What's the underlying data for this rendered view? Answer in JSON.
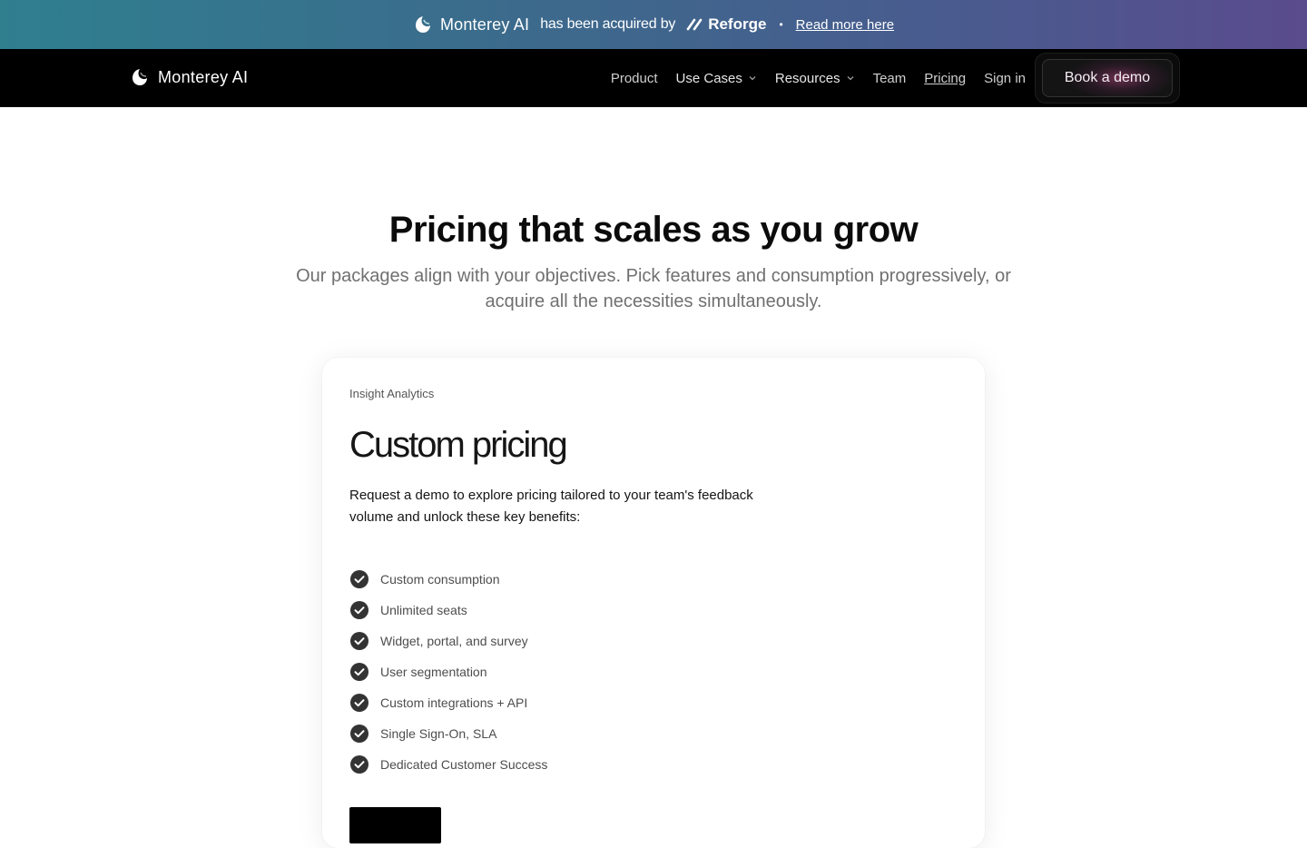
{
  "announcement": {
    "brand": "Monterey AI",
    "acquired_text": "has been acquired by",
    "acquirer": "Reforge",
    "separator": "•",
    "link": "Read more here"
  },
  "nav": {
    "logo_text": "Monterey AI",
    "links": [
      {
        "label": "Product",
        "dropdown": false
      },
      {
        "label": "Use Cases",
        "dropdown": true
      },
      {
        "label": "Resources",
        "dropdown": true
      },
      {
        "label": "Team",
        "dropdown": false
      },
      {
        "label": "Pricing",
        "dropdown": false,
        "active": true
      },
      {
        "label": "Sign in",
        "dropdown": false
      }
    ],
    "cta": "Book a demo"
  },
  "hero": {
    "title": "Pricing that scales as you grow",
    "subtitle": "Our packages align with your objectives. Pick features and consumption progressively, or acquire all the necessities simultaneously."
  },
  "card": {
    "eyebrow": "Insight Analytics",
    "price": "Custom pricing",
    "description": "Request a demo to explore pricing tailored to your team's feedback volume and unlock these key benefits:",
    "features": [
      "Custom consumption",
      "Unlimited seats",
      "Widget, portal, and survey",
      "User segmentation",
      "Custom integrations + API",
      "Single Sign-On, SLA",
      "Dedicated Customer Success"
    ]
  },
  "colors": {
    "announce_gradient_start": "#2f7f8f",
    "announce_gradient_end": "#5a4b8d",
    "nav_bg": "#000000",
    "check_icon": "#333333"
  }
}
